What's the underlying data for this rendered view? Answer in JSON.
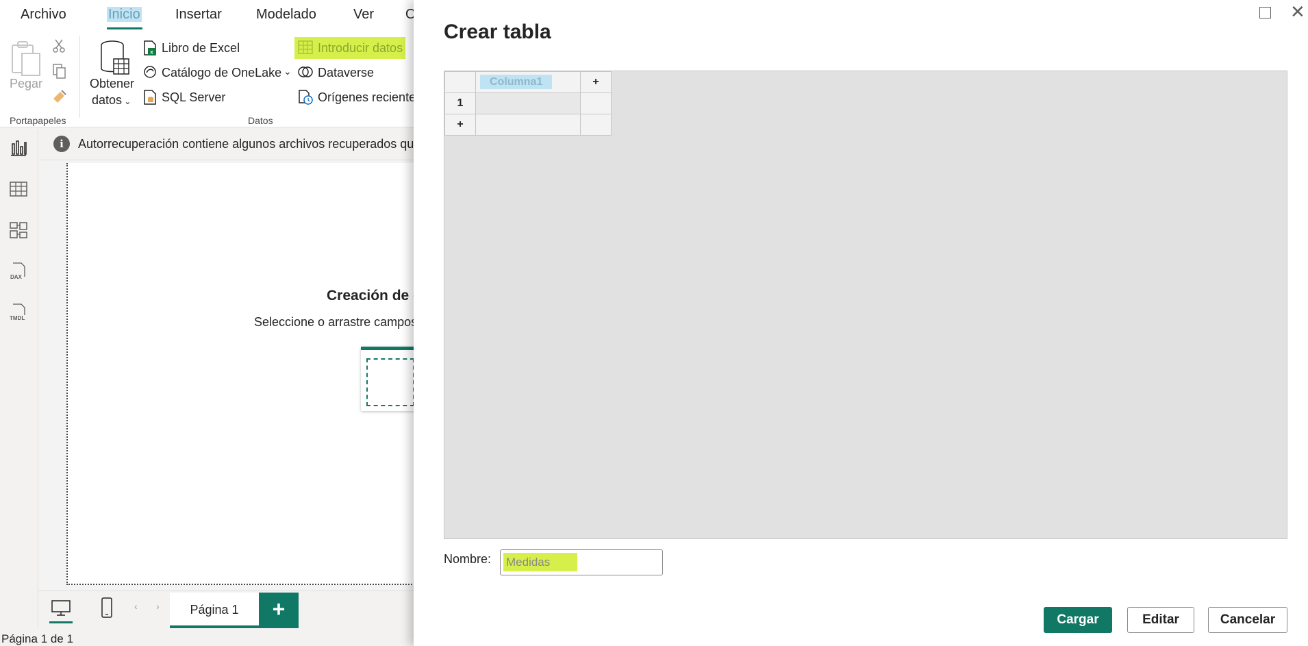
{
  "menu": {
    "items": [
      "Archivo",
      "Inicio",
      "Insertar",
      "Modelado",
      "Ver",
      "O"
    ],
    "active": "Inicio"
  },
  "ribbon": {
    "paste_label": "Pegar",
    "clipboard_group": "Portapapeles",
    "get_data_line1": "Obtener",
    "get_data_line2": "datos",
    "excel_label": "Libro de Excel",
    "onelake_label": "Catálogo de OneLake",
    "sql_label": "SQL Server",
    "enter_data_label": "Introducir datos",
    "dataverse_label": "Dataverse",
    "recent_sources_label": "Orígenes recientes",
    "data_group": "Datos"
  },
  "infobar": {
    "text": "Autorrecuperación contiene algunos archivos recuperados que"
  },
  "canvas": {
    "title": "Creación de o",
    "subtitle": "Seleccione o arrastre campos"
  },
  "pages": {
    "tab_label": "Página 1",
    "add_label": "+",
    "status": "Página 1 de 1"
  },
  "dialog": {
    "title": "Crear tabla",
    "columns": [
      "Columna1"
    ],
    "add_column": "+",
    "rows": [
      "1"
    ],
    "add_row": "+",
    "name_label": "Nombre:",
    "name_value": "Medidas",
    "buttons": {
      "load": "Cargar",
      "edit": "Editar",
      "cancel": "Cancelar"
    }
  },
  "colors": {
    "accent": "#117865",
    "highlight_blue": "#bfe3f2",
    "highlight_green": "#d6ef4a"
  }
}
